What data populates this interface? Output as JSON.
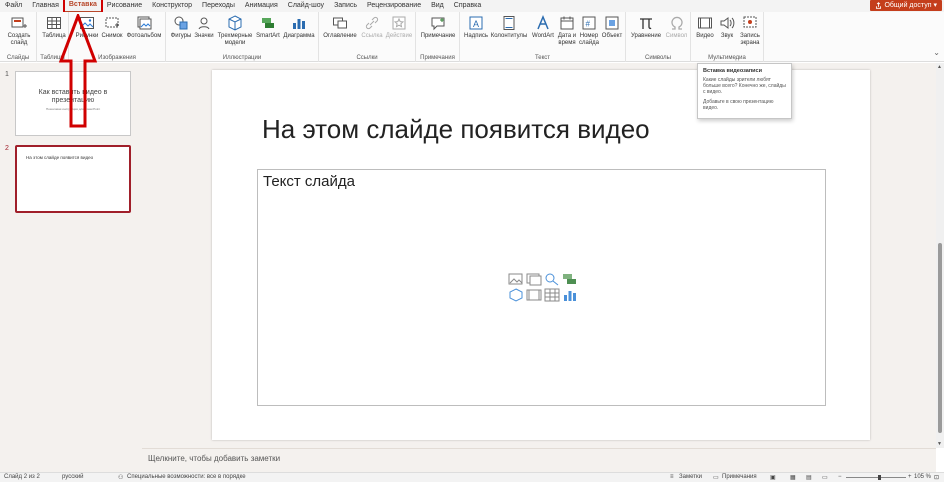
{
  "menu": {
    "tabs": [
      "Файл",
      "Главная",
      "Вставка",
      "Рисование",
      "Конструктор",
      "Переходы",
      "Анимация",
      "Слайд-шоу",
      "Запись",
      "Рецензирование",
      "Вид",
      "Справка"
    ],
    "share_label": "Общий доступ"
  },
  "ribbon": {
    "groups": {
      "slides": "Слайды",
      "tables": "Таблицы",
      "images": "Изображения",
      "illustrations": "Иллюстрации",
      "links": "Ссылки",
      "comments": "Примечания",
      "text": "Текст",
      "symbols": "Символы",
      "media": "Мультимедиа"
    },
    "buttons": {
      "new_slide": "Создать слайд",
      "table": "Таблица",
      "pictures": "Рисунки",
      "screenshot": "Снимок",
      "photo_album": "Фотоальбом",
      "shapes": "Фигуры",
      "icons": "Значки",
      "3d_models": "Трехмерные модели",
      "smartart": "SmartArt",
      "chart": "Диаграмма",
      "zoom": "Оглавление",
      "link": "Ссылка",
      "action": "Действие",
      "comment": "Примечание",
      "textbox": "Надпись",
      "header_footer": "Колонтитулы",
      "wordart": "WordArt",
      "date_time": "Дата и время",
      "slide_number": "Номер слайда",
      "object": "Объект",
      "equation": "Уравнение",
      "symbol": "Символ",
      "video": "Видео",
      "audio": "Звук",
      "screen_recording": "Запись экрана"
    }
  },
  "thumbnails": [
    {
      "number": "1",
      "title": "Как вставить видео в презентацию",
      "subtitle": "Пошаговая инструкция для PowerPoint"
    },
    {
      "number": "2",
      "body": "На этом слайде появится видео"
    }
  ],
  "slide": {
    "title": "На этом слайде появится видео",
    "placeholder_text": "Текст слайда"
  },
  "tooltip": {
    "title": "Вставка видеозаписи",
    "body1": "Какие слайды зрители любят больше всего? Конечно же, слайды с видео.",
    "body2": "Добавьте в свою презентацию видео."
  },
  "notes": {
    "placeholder": "Щелкните, чтобы добавить заметки"
  },
  "status": {
    "slide_counter": "Слайд 2 из 2",
    "language": "русский",
    "accessibility": "Специальные возможности: все в порядке",
    "notes_btn": "Заметки",
    "comments_btn": "Примечания",
    "zoom": "105 %"
  },
  "colors": {
    "accent": "#b7472a",
    "share": "#c43e1c",
    "highlight": "#d00000",
    "selected_thumb": "#a01f2a"
  }
}
